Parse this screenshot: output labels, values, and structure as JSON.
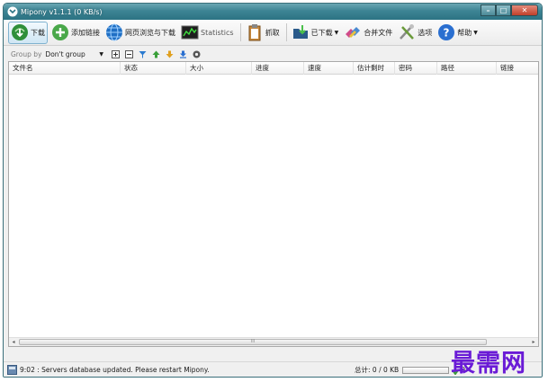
{
  "window": {
    "title": "Mipony v1.1.1 (0 KB/s)",
    "controls": {
      "minimize": "–",
      "maximize": "□",
      "close": "✕"
    }
  },
  "toolbar": {
    "buttons": [
      {
        "label": "下载",
        "icon": "download-globe-icon",
        "active": true
      },
      {
        "label": "添加链接",
        "icon": "add-link-icon"
      },
      {
        "label": "网页浏览与下载",
        "icon": "web-browser-icon"
      },
      {
        "label": "Statistics",
        "icon": "statistics-icon"
      },
      {
        "label": "抓取",
        "icon": "clipboard-icon"
      },
      {
        "label": "已下载",
        "icon": "downloaded-folder-icon",
        "dropdown": true
      },
      {
        "label": "合并文件",
        "icon": "join-files-icon"
      },
      {
        "label": "选项",
        "icon": "options-tools-icon"
      },
      {
        "label": "帮助",
        "icon": "help-icon",
        "dropdown": true
      }
    ]
  },
  "groupbar": {
    "label": "Group by",
    "value": "Don't group",
    "icons": [
      "expand-all-icon",
      "collapse-all-icon",
      "filter-icon",
      "move-up-icon",
      "move-down-icon",
      "move-bottom-icon",
      "settings-icon"
    ]
  },
  "list": {
    "columns": [
      "文件名",
      "状态",
      "大小",
      "进度",
      "速度",
      "估计剩时",
      "密码",
      "路径",
      "链接"
    ],
    "rows": []
  },
  "scrollbar": {
    "grip": "III",
    "left": "◂",
    "right": "▸"
  },
  "statusbar": {
    "message": "9:02 : Servers database updated. Please restart Mipony.",
    "total": "总计: 0 / 0 KB",
    "rate": "0"
  },
  "watermark": "最需网",
  "colors": {
    "titlebar": "#3d8494",
    "accent_green": "#3a9a3a",
    "watermark": "#6a1bd6"
  }
}
